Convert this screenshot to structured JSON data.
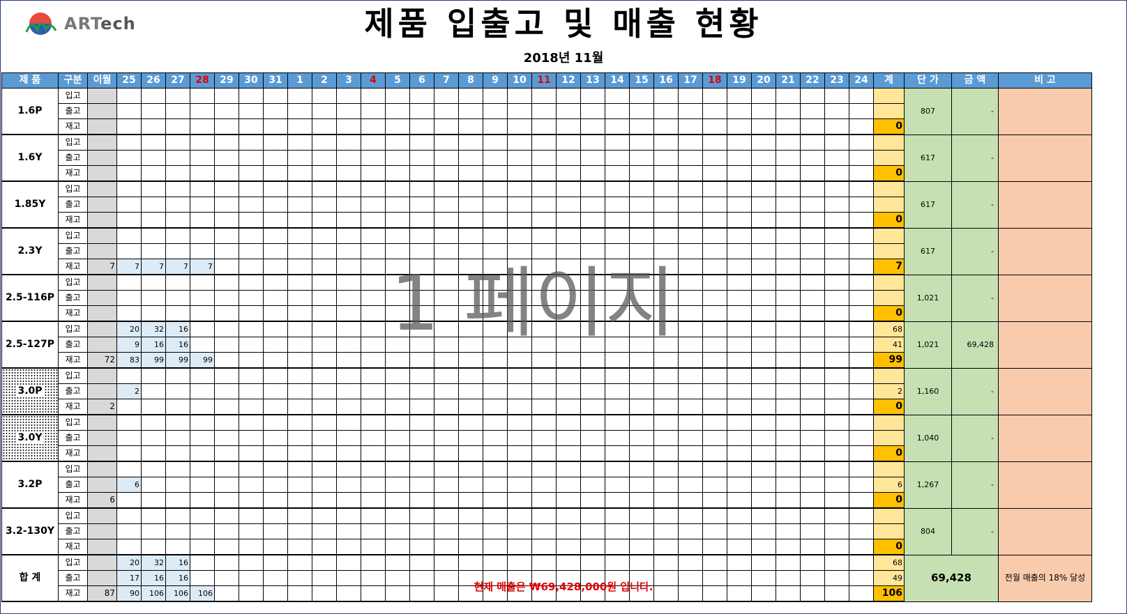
{
  "title": "제품 입출고 및 매출 현황",
  "subtitle": "2018년 11월",
  "logo": {
    "text_a": "ART",
    "text_b": "ech",
    "icon": "artech-logo-icon"
  },
  "watermark": "1 페이지",
  "footer": "현재 매출은 ₩69,428,000원 입니다.",
  "colors": {
    "header": "#5b9bd5",
    "prev": "#d9d9d9",
    "value": "#ddebf7",
    "total": "#ffe699",
    "stock_total": "#ffc000",
    "unit": "#c6e0b4",
    "remark": "#f8cbad",
    "weekend": "#e00000"
  },
  "headers": {
    "product": "제 품",
    "category": "구분",
    "prev": "이월",
    "days": [
      "25",
      "26",
      "27",
      "28",
      "29",
      "30",
      "31",
      "1",
      "2",
      "3",
      "4",
      "5",
      "6",
      "7",
      "8",
      "9",
      "10",
      "11",
      "12",
      "13",
      "14",
      "15",
      "16",
      "17",
      "18",
      "19",
      "20",
      "21",
      "22",
      "23",
      "24"
    ],
    "red_days": [
      "28",
      "4",
      "11",
      "18"
    ],
    "total": "계",
    "unit_price": "단 가",
    "amount": "금 액",
    "remark": "비 고"
  },
  "row_labels": [
    "입고",
    "출고",
    "재고"
  ],
  "products": [
    {
      "name": "1.6P",
      "unit_price": "807",
      "amount": "-",
      "totals": [
        "",
        "",
        "0"
      ],
      "rows": [
        [
          ""
        ],
        [
          ""
        ],
        [
          ""
        ]
      ],
      "dotted": false
    },
    {
      "name": "1.6Y",
      "unit_price": "617",
      "amount": "-",
      "totals": [
        "",
        "",
        "0"
      ],
      "rows": [
        [
          ""
        ],
        [
          ""
        ],
        [
          ""
        ]
      ],
      "dotted": false
    },
    {
      "name": "1.85Y",
      "unit_price": "617",
      "amount": "-",
      "totals": [
        "",
        "",
        "0"
      ],
      "rows": [
        [
          ""
        ],
        [
          ""
        ],
        [
          ""
        ]
      ],
      "dotted": false
    },
    {
      "name": "2.3Y",
      "unit_price": "617",
      "amount": "-",
      "totals": [
        "",
        "",
        "7"
      ],
      "rows": [
        [
          ""
        ],
        [
          ""
        ],
        [
          "7",
          "7",
          "7",
          "7",
          "7"
        ]
      ],
      "dotted": false
    },
    {
      "name": "2.5-116P",
      "unit_price": "1,021",
      "amount": "-",
      "totals": [
        "",
        "",
        "0"
      ],
      "rows": [
        [
          ""
        ],
        [
          ""
        ],
        [
          ""
        ]
      ],
      "dotted": false
    },
    {
      "name": "2.5-127P",
      "unit_price": "1,021",
      "amount": "69,428",
      "totals": [
        "68",
        "41",
        "99"
      ],
      "rows": [
        [
          "",
          "20",
          "32",
          "16"
        ],
        [
          "",
          "9",
          "16",
          "16"
        ],
        [
          "72",
          "83",
          "99",
          "99",
          "99"
        ]
      ],
      "dotted": false
    },
    {
      "name": "3.0P",
      "unit_price": "1,160",
      "amount": "-",
      "totals": [
        "",
        "2",
        "0"
      ],
      "rows": [
        [
          ""
        ],
        [
          "",
          "2"
        ],
        [
          "2"
        ]
      ],
      "dotted": true
    },
    {
      "name": "3.0Y",
      "unit_price": "1,040",
      "amount": "-",
      "totals": [
        "",
        "",
        "0"
      ],
      "rows": [
        [
          ""
        ],
        [
          ""
        ],
        [
          ""
        ]
      ],
      "dotted": true
    },
    {
      "name": "3.2P",
      "unit_price": "1,267",
      "amount": "-",
      "totals": [
        "",
        "6",
        "0"
      ],
      "rows": [
        [
          ""
        ],
        [
          "",
          "6"
        ],
        [
          "6"
        ]
      ],
      "dotted": false
    },
    {
      "name": "3.2-130Y",
      "unit_price": "804",
      "amount": "-",
      "totals": [
        "",
        "",
        "0"
      ],
      "rows": [
        [
          ""
        ],
        [
          ""
        ],
        [
          ""
        ]
      ],
      "dotted": false
    }
  ],
  "summary": {
    "name": "합 계",
    "totals": [
      "68",
      "49",
      "106"
    ],
    "rows": [
      [
        "",
        "20",
        "32",
        "16"
      ],
      [
        "",
        "17",
        "16",
        "16"
      ],
      [
        "87",
        "90",
        "106",
        "106",
        "106"
      ]
    ],
    "amount": "69,428",
    "remark": "전월 매출의 18% 달성"
  }
}
